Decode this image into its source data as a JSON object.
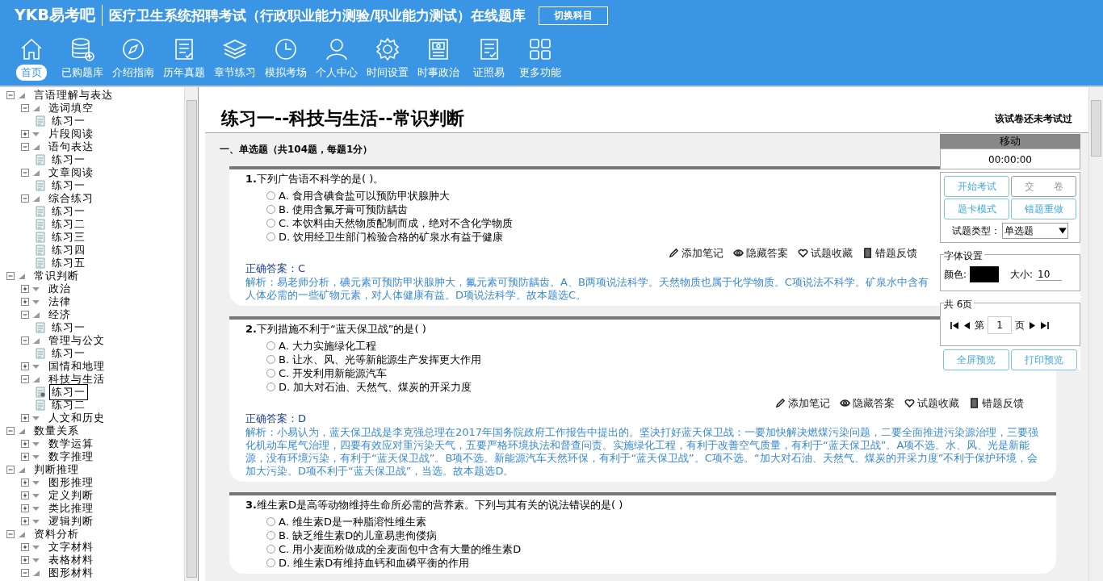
{
  "header": {
    "logo": "YKB易考吧",
    "title": "医疗卫生系统招聘考试（行政职业能力测验/职业能力测试）在线题库",
    "switch_button": "切换科目"
  },
  "nav": [
    {
      "label": "首页",
      "selected": true
    },
    {
      "label": "已购题库",
      "selected": false
    },
    {
      "label": "介绍指南",
      "selected": false
    },
    {
      "label": "历年真题",
      "selected": false
    },
    {
      "label": "章节练习",
      "selected": false
    },
    {
      "label": "模拟考场",
      "selected": false
    },
    {
      "label": "个人中心",
      "selected": false
    },
    {
      "label": "时间设置",
      "selected": false
    },
    {
      "label": "时事政治",
      "selected": false
    },
    {
      "label": "证照易",
      "selected": false
    },
    {
      "label": "更多功能",
      "selected": false
    }
  ],
  "tree": [
    {
      "label": "言语理解与表达",
      "expanded": true,
      "children": [
        {
          "label": "选词填空",
          "expanded": true,
          "children": [
            {
              "label": "练习一",
              "selected": false
            }
          ]
        },
        {
          "label": "片段阅读",
          "expanded": false
        },
        {
          "label": "语句表达",
          "expanded": true,
          "children": [
            {
              "label": "练习一",
              "selected": false
            }
          ]
        },
        {
          "label": "文章阅读",
          "expanded": true,
          "children": [
            {
              "label": "练习一",
              "selected": false
            }
          ]
        },
        {
          "label": "综合练习",
          "expanded": true,
          "children": [
            {
              "label": "练习一",
              "selected": false
            },
            {
              "label": "练习二",
              "selected": false
            },
            {
              "label": "练习三",
              "selected": false
            },
            {
              "label": "练习四",
              "selected": false
            },
            {
              "label": "练习五",
              "selected": false
            }
          ]
        }
      ]
    },
    {
      "label": "常识判断",
      "expanded": true,
      "children": [
        {
          "label": "政治",
          "expanded": false
        },
        {
          "label": "法律",
          "expanded": false
        },
        {
          "label": "经济",
          "expanded": true,
          "children": [
            {
              "label": "练习一",
              "selected": false
            }
          ]
        },
        {
          "label": "管理与公文",
          "expanded": true,
          "children": [
            {
              "label": "练习一",
              "selected": false
            }
          ]
        },
        {
          "label": "国情和地理",
          "expanded": false
        },
        {
          "label": "科技与生活",
          "expanded": true,
          "children": [
            {
              "label": "练习一",
              "selected": true
            },
            {
              "label": "练习二",
              "selected": false
            }
          ]
        },
        {
          "label": "人文和历史",
          "expanded": false
        }
      ]
    },
    {
      "label": "数量关系",
      "expanded": true,
      "children": [
        {
          "label": "数学运算",
          "expanded": false
        },
        {
          "label": "数字推理",
          "expanded": false
        }
      ]
    },
    {
      "label": "判断推理",
      "expanded": true,
      "children": [
        {
          "label": "图形推理",
          "expanded": false
        },
        {
          "label": "定义判断",
          "expanded": false
        },
        {
          "label": "类比推理",
          "expanded": false
        },
        {
          "label": "逻辑判断",
          "expanded": false
        }
      ]
    },
    {
      "label": "资料分析",
      "expanded": true,
      "children": [
        {
          "label": "文字材料",
          "expanded": false
        },
        {
          "label": "表格材料",
          "expanded": false
        },
        {
          "label": "图形材料",
          "expanded": true
        }
      ]
    }
  ],
  "paper": {
    "title": "练习一--科技与生活--常识判断",
    "status": "该试卷还未考试过",
    "section": "一、单选题（共104题，每题1分）"
  },
  "questions": [
    {
      "number": "1.",
      "stem": "下列广告语不科学的是( )。",
      "options": [
        {
          "label": "A. 食用含碘食盐可以预防甲状腺肿大",
          "selected": false
        },
        {
          "label": "B. 使用含氟牙膏可预防龋齿",
          "selected": false
        },
        {
          "label": "C. 本饮料由天然物质配制而成，绝对不含化学物质",
          "selected": false
        },
        {
          "label": "D. 饮用经卫生部门检验合格的矿泉水有益于健康",
          "selected": false
        }
      ],
      "actions": [
        "添加笔记",
        "隐藏答案",
        "试题收藏",
        "错题反馈"
      ],
      "answer": "正确答案：C",
      "explanation": "解析：易老师分析，碘元素可预防甲状腺肿大，氟元素可预防龋齿。A、B两项说法科学。天然物质也属于化学物质。C项说法不科学。矿泉水中含有人体必需的一些矿物元素，对人体健康有益。D项说法科学。故本题选C。"
    },
    {
      "number": "2.",
      "stem": "下列措施不利于“蓝天保卫战”的是( )",
      "options": [
        {
          "label": "A. 大力实施绿化工程",
          "selected": false
        },
        {
          "label": "B. 让水、风、光等新能源生产发挥更大作用",
          "selected": false
        },
        {
          "label": "C. 开发利用新能源汽车",
          "selected": false
        },
        {
          "label": "D. 加大对石油、天然气、煤炭的开采力度",
          "selected": false
        }
      ],
      "actions": [
        "添加笔记",
        "隐藏答案",
        "试题收藏",
        "错题反馈"
      ],
      "answer": "正确答案：D",
      "explanation": "解析：小易认为，蓝天保卫战是李克强总理在2017年国务院政府工作报告中提出的。坚决打好蓝天保卫战：一要加快解决燃煤污染问题，二要全面推进污染源治理，三要强化机动车尾气治理，四要有效应对重污染天气，五要严格环境执法和督查问责。实施绿化工程，有利于改善空气质量，有利于“蓝天保卫战”。A项不选。水、风、光是新能源，没有环境污染，有利于“蓝天保卫战”。B项不选。新能源汽车天然环保，有利于“蓝天保卫战”。C项不选。“加大对石油、天然气、煤炭的开采力度”不利于保护环境，会加大污染。D项不利于“蓝天保卫战”，当选。故本题选D。"
    },
    {
      "number": "3.",
      "stem": "维生素D是高等动物维持生命所必需的营养素。下列与其有关的说法错误的是( )",
      "options": [
        {
          "label": "A. 维生素D是一种脂溶性维生素",
          "selected": false
        },
        {
          "label": "B. 缺乏维生素D的儿童易患佝偻病",
          "selected": false
        },
        {
          "label": "C. 用小麦面粉做成的全麦面包中含有大量的维生素D",
          "selected": false
        },
        {
          "label": "D. 维生素D有维持血钙和血磷平衡的作用",
          "selected": false
        }
      ]
    }
  ],
  "panel": {
    "title": "移动",
    "timer": "00:00:00",
    "buttons": [
      {
        "label": "开始考试",
        "disabled": false
      },
      {
        "label": "交　　卷",
        "disabled": true
      },
      {
        "label": "题卡模式",
        "disabled": false
      },
      {
        "label": "错题重做",
        "disabled": false
      }
    ],
    "type_label": "试题类型：",
    "type_value": "单选题",
    "font_legend": "字体设置",
    "color_label": "颜色:",
    "color": "#000000",
    "size_label": "大小:",
    "size_value": "10",
    "pages_legend": "共 6页",
    "page_prefix": "第",
    "page_value": "1",
    "page_suffix": "页",
    "bottom_buttons": [
      "全屏预览",
      "打印预览"
    ]
  }
}
